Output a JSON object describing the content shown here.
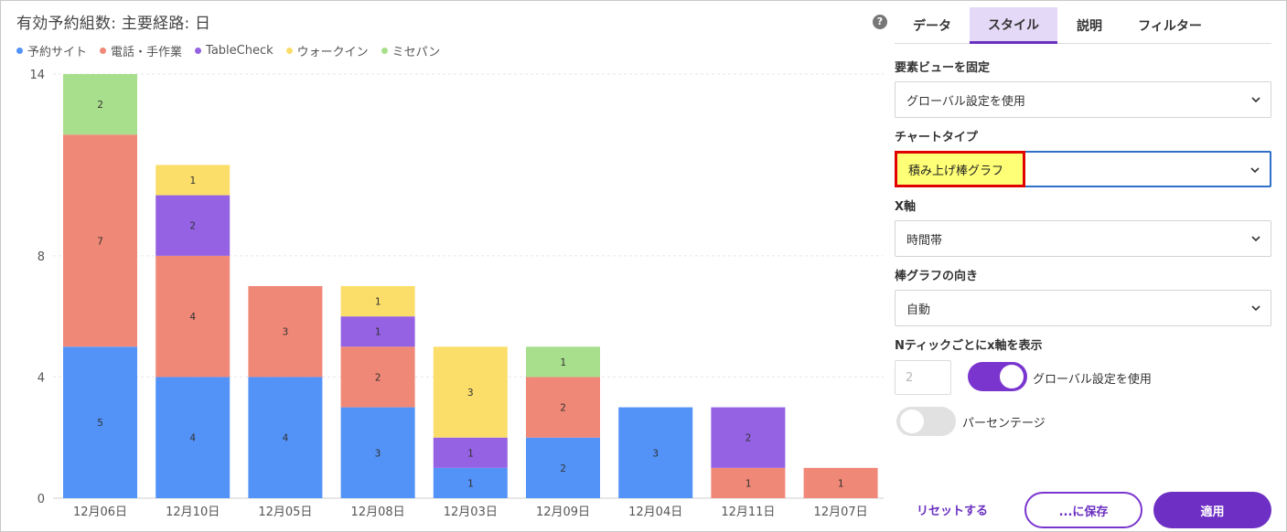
{
  "chart_data": {
    "type": "bar",
    "stacked": true,
    "title": "有効予約組数: 主要経路: 日",
    "categories": [
      "12月06日",
      "12月10日",
      "12月05日",
      "12月08日",
      "12月03日",
      "12月09日",
      "12月04日",
      "12月11日",
      "12月07日"
    ],
    "series": [
      {
        "name": "予約サイト",
        "color": "#5393f8",
        "values": [
          5,
          4,
          4,
          3,
          1,
          2,
          3,
          0,
          0
        ]
      },
      {
        "name": "電話・手作業",
        "color": "#f08877",
        "values": [
          7,
          4,
          3,
          2,
          0,
          2,
          0,
          1,
          1
        ]
      },
      {
        "name": "TableCheck",
        "color": "#9462e3",
        "values": [
          0,
          2,
          0,
          1,
          1,
          0,
          0,
          2,
          0
        ]
      },
      {
        "name": "ウォークイン",
        "color": "#fbde6a",
        "values": [
          0,
          1,
          0,
          1,
          3,
          0,
          0,
          0,
          0
        ]
      },
      {
        "name": "ミセパン",
        "color": "#a8df8c",
        "values": [
          2,
          0,
          0,
          0,
          0,
          1,
          0,
          0,
          0
        ]
      }
    ],
    "yticks": [
      0,
      4,
      8,
      14
    ],
    "ylim": [
      0,
      14
    ],
    "grid": true,
    "legend_position": "top-left"
  },
  "help_icon": "?",
  "panel": {
    "tabs": [
      "データ",
      "スタイル",
      "説明",
      "フィルター"
    ],
    "active_tab": "スタイル",
    "pin_view": {
      "label": "要素ビューを固定",
      "value": "グローバル設定を使用"
    },
    "chart_type": {
      "label": "チャートタイプ",
      "value": "積み上げ棒グラフ"
    },
    "x_axis": {
      "label": "X軸",
      "value": "時間帯"
    },
    "bar_direction": {
      "label": "棒グラフの向き",
      "value": "自動"
    },
    "nth_tick": {
      "label": "Nティックごとにx軸を表示",
      "input_placeholder": "2",
      "toggle_label": "グローバル設定を使用",
      "toggle_on": true
    },
    "percentage": {
      "label": "パーセンテージ",
      "toggle_on": false
    },
    "buttons": {
      "reset": "リセットする",
      "save": "...に保存",
      "apply": "適用"
    }
  },
  "colors": {
    "accent": "#6e2fc4",
    "highlight": "#ffff77",
    "highlight_border": "#e00000"
  }
}
